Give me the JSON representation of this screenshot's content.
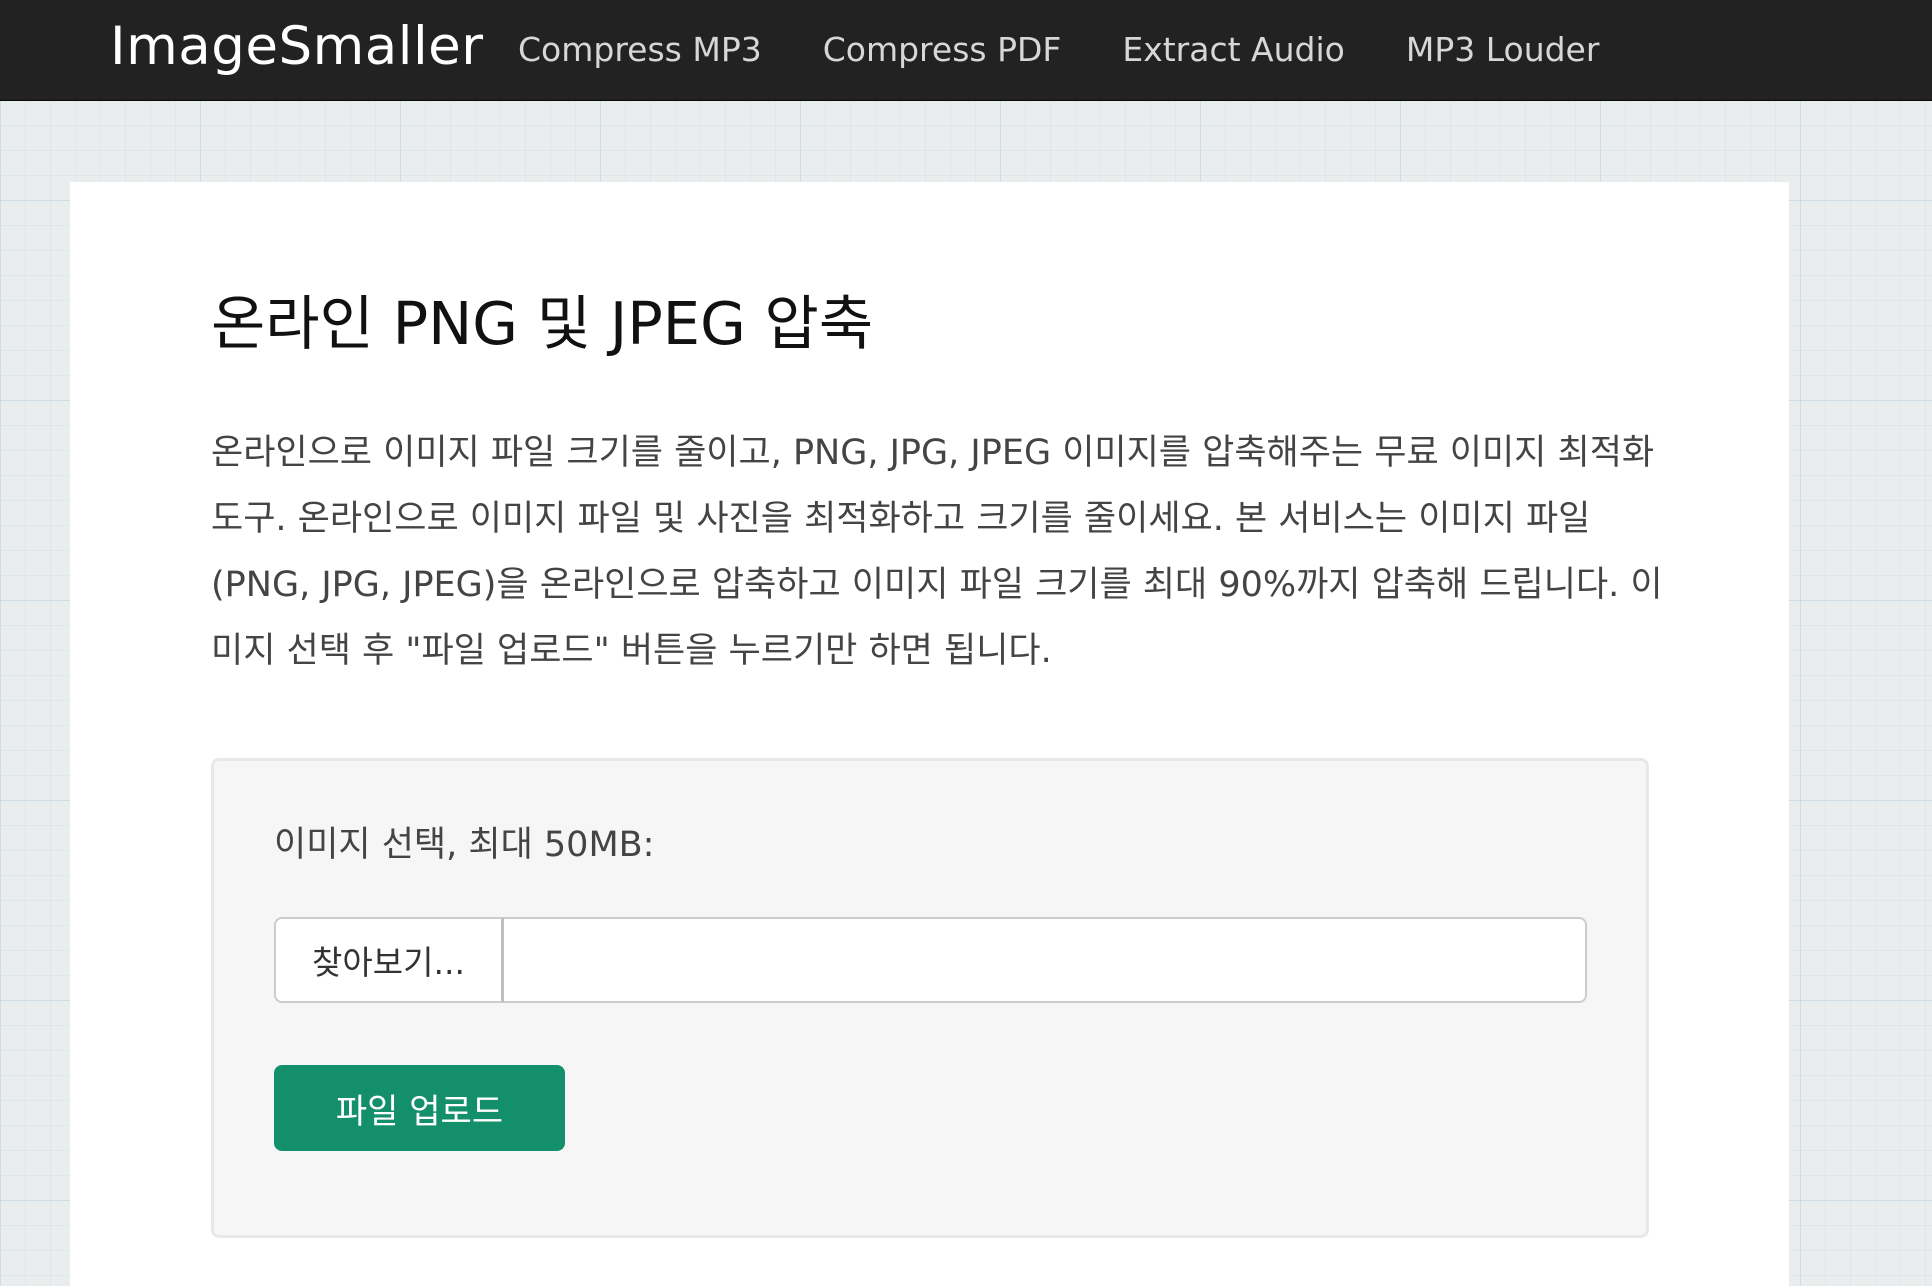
{
  "navbar": {
    "brand": "ImageSmaller",
    "links": [
      {
        "label": "Compress MP3"
      },
      {
        "label": "Compress PDF"
      },
      {
        "label": "Extract Audio"
      },
      {
        "label": "MP3 Louder"
      }
    ],
    "background_color": "#222222"
  },
  "main": {
    "title": "온라인 PNG 및 JPEG 압축",
    "description": "온라인으로 이미지 파일 크기를 줄이고, PNG, JPG, JPEG 이미지를 압축해주는 무료 이미지 최적화 도구. 온라인으로 이미지 파일 및 사진을 최적화하고 크기를 줄이세요. 본 서비스는 이미지 파일(PNG, JPG, JPEG)을 온라인으로 압축하고 이미지 파일 크기를 최대 90%까지 압축해 드립니다. 이미지 선택 후 \"파일 업로드\" 버튼을 누르기만 하면 됩니다."
  },
  "upload": {
    "label": "이미지 선택, 최대 50MB:",
    "browse_label": "찾아보기...",
    "file_value": "",
    "upload_button": "파일 업로드",
    "accent_color": "#148f6b"
  }
}
